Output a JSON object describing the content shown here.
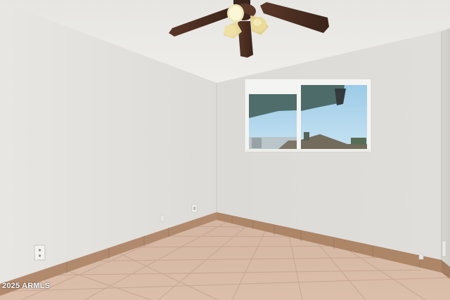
{
  "photo": {
    "subject": "empty-room-with-ceiling-fan-and-window",
    "watermark_text": "2025 ARMLS",
    "colors": {
      "ceiling": "#ebeae6",
      "left_wall": "#e3e1dd",
      "back_wall": "#dedcd8",
      "right_wall": "#d6d3cf",
      "floor_tile": "#d7b9a4",
      "grout": "#c9a994",
      "baseboard": "#b08669",
      "fan_blade": "#4a2e22",
      "fan_light": "#e8d89a",
      "window_frame": "#f4f4f2",
      "sky": "#a9d4ec",
      "window_reflection": "#4f6e6b"
    }
  }
}
